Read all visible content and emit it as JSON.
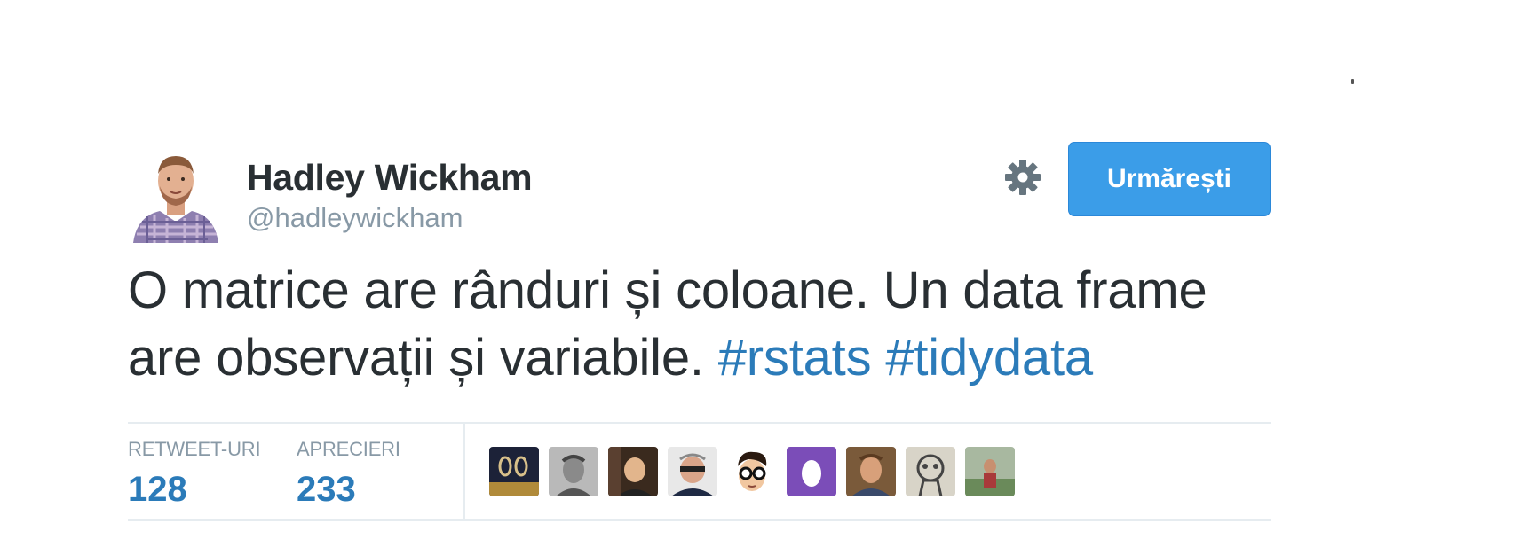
{
  "tweet": {
    "author": {
      "name": "Hadley Wickham",
      "handle": "@hadleywickham",
      "avatar_icon": "profile-photo"
    },
    "follow_label": "Urmărești",
    "settings_icon": "gear-icon",
    "text_line1": "O matrice are rânduri și coloane. Un data frame",
    "text_line2_plain": "are observații și variabile.",
    "hashtags": [
      "#rstats",
      "#tidydata"
    ]
  },
  "stats": {
    "retweets": {
      "label": "RETWEET-URI",
      "value": "128"
    },
    "likes": {
      "label": "APRECIERI",
      "value": "233"
    }
  },
  "likers": [
    {
      "icon": "avatar-photo"
    },
    {
      "icon": "avatar-photo"
    },
    {
      "icon": "avatar-photo"
    },
    {
      "icon": "avatar-photo"
    },
    {
      "icon": "avatar-cartoon-glasses"
    },
    {
      "icon": "avatar-egg"
    },
    {
      "icon": "avatar-photo"
    },
    {
      "icon": "avatar-drawing"
    },
    {
      "icon": "avatar-photo"
    }
  ],
  "colors": {
    "follow_button": "#3b9de8",
    "link": "#2b7bb9",
    "text": "#292f33",
    "muted": "#8899a6",
    "border": "#e6ecf0"
  }
}
